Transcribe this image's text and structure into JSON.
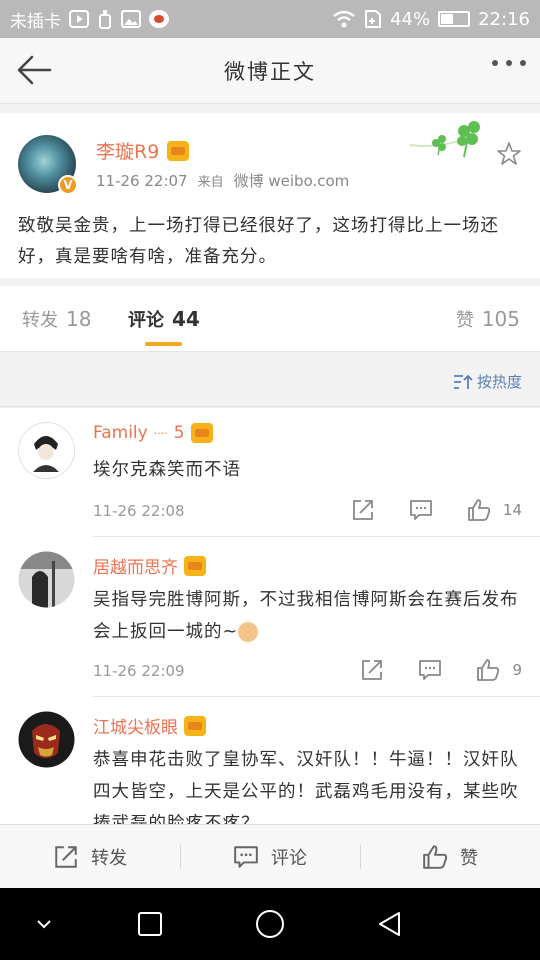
{
  "status_bar": {
    "carrier": "未插卡",
    "battery_percent": "44%",
    "battery_level": 0.44,
    "time": "22:16",
    "icons": [
      "play-icon",
      "cleaner-icon",
      "image-icon",
      "weibo-icon",
      "wifi-icon",
      "sim-icon",
      "battery-icon"
    ]
  },
  "header": {
    "title": "微博正文",
    "back_icon": "arrow-left-icon",
    "more_icon": "more-dots-icon"
  },
  "post": {
    "author": "李璇R9",
    "verified_badge": "V",
    "time": "11-26 22:07",
    "source_prefix": "来自",
    "source_name": "微博 weibo.com",
    "text": "致敬吴金贵，上一场打得已经很好了，这场打得比上一场还好，真是要啥有啥，准备充分。"
  },
  "tabs": {
    "repost": {
      "label": "转发",
      "count": "18"
    },
    "comment": {
      "label": "评论",
      "count": "44"
    },
    "like": {
      "label": "赞",
      "count": "105"
    }
  },
  "sort": {
    "label": "按热度"
  },
  "comments": [
    {
      "name": "Family",
      "name_suffix": "5",
      "text": "埃尔克森笑而不语",
      "time": "11-26 22:08",
      "likes": "14"
    },
    {
      "name": "居越而思齐",
      "text": "吴指导完胜博阿斯，不过我相信博阿斯会在赛后发布会上扳回一城的~",
      "time": "11-26 22:09",
      "likes": "9"
    },
    {
      "name": "江城尖板眼",
      "text": "恭喜申花击败了皇协军、汉奸队！！牛逼！！汉奸队四大皆空，上天是公平的！武磊鸡毛用没有，某些吹捧武磊的脸疼不疼？"
    }
  ],
  "bottom_bar": {
    "repost": "转发",
    "comment": "评论",
    "like": "赞"
  },
  "colors": {
    "accent_orange": "#eb7350",
    "tab_underline": "#f5a623",
    "link_blue": "#5b7fb4"
  }
}
